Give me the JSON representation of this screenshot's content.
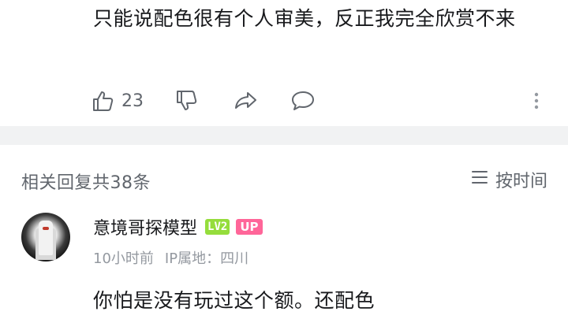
{
  "comment": {
    "text": "只能说配色很有个人审美，反正我完全欣赏不来",
    "like_count": "23"
  },
  "replies": {
    "count_label": "相关回复共38条",
    "sort_label": "按时间"
  },
  "reply": {
    "username": "意境哥探模型",
    "level_badge": "LV2",
    "up_badge": "UP",
    "time": "10小时前",
    "ip_location": "IP属地：四川",
    "text": "你怕是没有玩过这个额。还配色"
  },
  "icons": {
    "like": "thumbs-up-icon",
    "dislike": "thumbs-down-icon",
    "share": "share-icon",
    "reply": "comment-icon",
    "more": "more-vertical-icon",
    "sort": "list-icon"
  },
  "colors": {
    "text": "#18191c",
    "secondary": "#61666d",
    "meta": "#9499a0",
    "divider": "#f1f2f3",
    "level_badge": "#95dd3c",
    "up_badge": "#ff6699"
  }
}
